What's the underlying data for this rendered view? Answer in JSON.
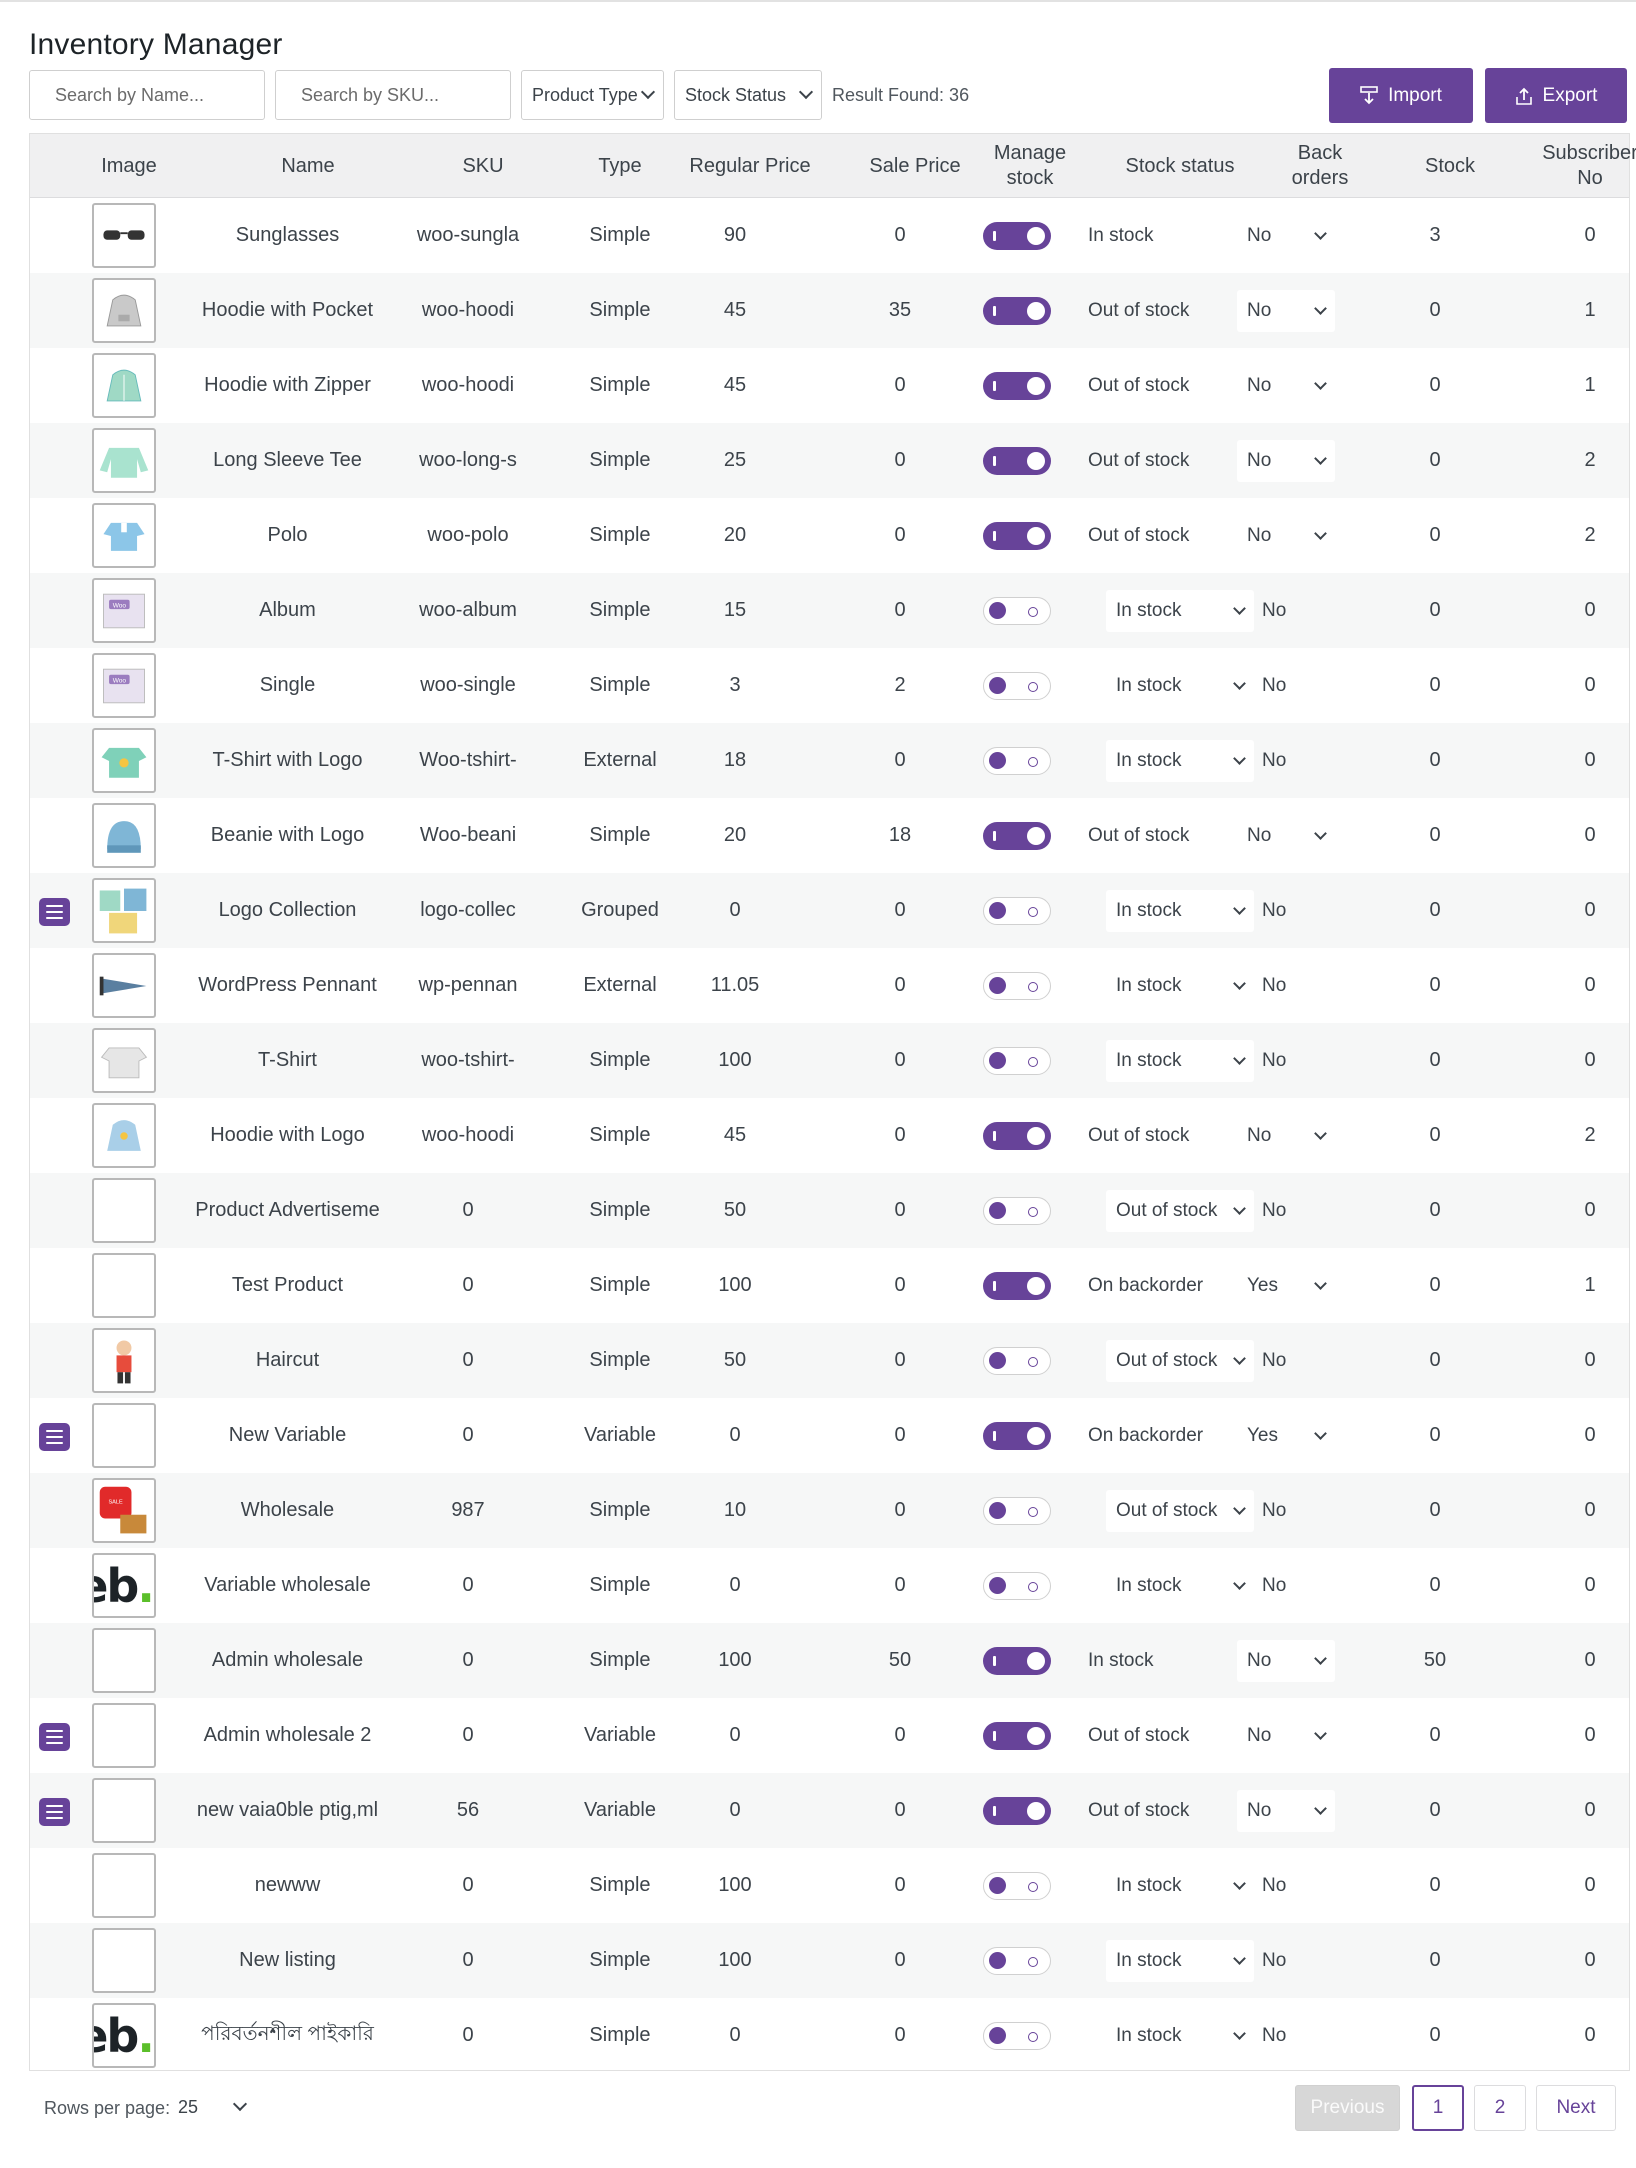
{
  "app": {
    "title": "Inventory Manager"
  },
  "toolbar": {
    "search_name_placeholder": "Search by Name...",
    "search_sku_placeholder": "Search by SKU...",
    "product_type_label": "Product Type",
    "stock_status_label": "Stock Status",
    "result_found": "Result Found: 36",
    "import_label": "Import",
    "export_label": "Export"
  },
  "table": {
    "headers": {
      "image": "Image",
      "name": "Name",
      "sku": "SKU",
      "type": "Type",
      "regular_price": "Regular Price",
      "sale_price": "Sale Price",
      "manage_stock_1": "Manage",
      "manage_stock_2": "stock",
      "stock_status": "Stock status",
      "back_orders_1": "Back",
      "back_orders_2": "orders",
      "stock": "Stock",
      "subscriber_1": "Subscriber",
      "subscriber_2": "No"
    },
    "rows": [
      {
        "image": "sunglasses",
        "variable": false,
        "name": "Sunglasses",
        "sku": "woo-sungla",
        "type": "Simple",
        "regular": "90",
        "sale": "0",
        "manage": true,
        "stock_status": "In stock",
        "backorders": "No",
        "stock": "3",
        "subscribers": "0"
      },
      {
        "image": "hoodie-pocket",
        "variable": false,
        "name": "Hoodie with Pocket",
        "sku": "woo-hoodi",
        "type": "Simple",
        "regular": "45",
        "sale": "35",
        "manage": true,
        "stock_status": "Out of stock",
        "backorders": "No",
        "stock": "0",
        "subscribers": "1"
      },
      {
        "image": "hoodie-zipper",
        "variable": false,
        "name": "Hoodie with Zipper",
        "sku": "woo-hoodi",
        "type": "Simple",
        "regular": "45",
        "sale": "0",
        "manage": true,
        "stock_status": "Out of stock",
        "backorders": "No",
        "stock": "0",
        "subscribers": "1"
      },
      {
        "image": "long-sleeve",
        "variable": false,
        "name": "Long Sleeve Tee",
        "sku": "woo-long-s",
        "type": "Simple",
        "regular": "25",
        "sale": "0",
        "manage": true,
        "stock_status": "Out of stock",
        "backorders": "No",
        "stock": "0",
        "subscribers": "2"
      },
      {
        "image": "polo",
        "variable": false,
        "name": "Polo",
        "sku": "woo-polo",
        "type": "Simple",
        "regular": "20",
        "sale": "0",
        "manage": true,
        "stock_status": "Out of stock",
        "backorders": "No",
        "stock": "0",
        "subscribers": "2"
      },
      {
        "image": "album",
        "variable": false,
        "name": "Album",
        "sku": "woo-album",
        "type": "Simple",
        "regular": "15",
        "sale": "0",
        "manage": false,
        "stock_status": "In stock",
        "backorders": "No",
        "stock": "0",
        "subscribers": "0"
      },
      {
        "image": "single",
        "variable": false,
        "name": "Single",
        "sku": "woo-single",
        "type": "Simple",
        "regular": "3",
        "sale": "2",
        "manage": false,
        "stock_status": "In stock",
        "backorders": "No",
        "stock": "0",
        "subscribers": "0"
      },
      {
        "image": "tshirt-logo",
        "variable": false,
        "name": "T-Shirt with Logo",
        "sku": "Woo-tshirt-",
        "type": "External",
        "regular": "18",
        "sale": "0",
        "manage": false,
        "stock_status": "In stock",
        "backorders": "No",
        "stock": "0",
        "subscribers": "0"
      },
      {
        "image": "beanie",
        "variable": false,
        "name": "Beanie with Logo",
        "sku": "Woo-beani",
        "type": "Simple",
        "regular": "20",
        "sale": "18",
        "manage": true,
        "stock_status": "Out of stock",
        "backorders": "No",
        "stock": "0",
        "subscribers": "0"
      },
      {
        "image": "logo-collection",
        "variable": true,
        "name": "Logo Collection",
        "sku": "logo-collec",
        "type": "Grouped",
        "regular": "0",
        "sale": "0",
        "manage": false,
        "stock_status": "In stock",
        "backorders": "No",
        "stock": "0",
        "subscribers": "0"
      },
      {
        "image": "pennant",
        "variable": false,
        "name": "WordPress Pennant",
        "sku": "wp-pennan",
        "type": "External",
        "regular": "11.05",
        "sale": "0",
        "manage": false,
        "stock_status": "In stock",
        "backorders": "No",
        "stock": "0",
        "subscribers": "0"
      },
      {
        "image": "tshirt",
        "variable": false,
        "name": "T-Shirt",
        "sku": "woo-tshirt-",
        "type": "Simple",
        "regular": "100",
        "sale": "0",
        "manage": false,
        "stock_status": "In stock",
        "backorders": "No",
        "stock": "0",
        "subscribers": "0"
      },
      {
        "image": "hoodie-logo",
        "variable": false,
        "name": "Hoodie with Logo",
        "sku": "woo-hoodi",
        "type": "Simple",
        "regular": "45",
        "sale": "0",
        "manage": true,
        "stock_status": "Out of stock",
        "backorders": "No",
        "stock": "0",
        "subscribers": "2"
      },
      {
        "image": "",
        "variable": false,
        "name": "Product Advertiseme",
        "sku": "0",
        "type": "Simple",
        "regular": "50",
        "sale": "0",
        "manage": false,
        "stock_status": "Out of stock",
        "backorders": "No",
        "stock": "0",
        "subscribers": "0"
      },
      {
        "image": "",
        "variable": false,
        "name": "Test Product",
        "sku": "0",
        "type": "Simple",
        "regular": "100",
        "sale": "0",
        "manage": true,
        "stock_status": "On backorder",
        "backorders": "Yes",
        "stock": "0",
        "subscribers": "1"
      },
      {
        "image": "haircut",
        "variable": false,
        "name": "Haircut",
        "sku": "0",
        "type": "Simple",
        "regular": "50",
        "sale": "0",
        "manage": false,
        "stock_status": "Out of stock",
        "backorders": "No",
        "stock": "0",
        "subscribers": "0"
      },
      {
        "image": "",
        "variable": true,
        "name": "New Variable",
        "sku": "0",
        "type": "Variable",
        "regular": "0",
        "sale": "0",
        "manage": true,
        "stock_status": "On backorder",
        "backorders": "Yes",
        "stock": "0",
        "subscribers": "0"
      },
      {
        "image": "wholesale",
        "variable": false,
        "name": "Wholesale",
        "sku": "987",
        "type": "Simple",
        "regular": "10",
        "sale": "0",
        "manage": false,
        "stock_status": "Out of stock",
        "backorders": "No",
        "stock": "0",
        "subscribers": "0"
      },
      {
        "image": "eb",
        "variable": false,
        "name": "Variable wholesale",
        "sku": "0",
        "type": "Simple",
        "regular": "0",
        "sale": "0",
        "manage": false,
        "stock_status": "In stock",
        "backorders": "No",
        "stock": "0",
        "subscribers": "0"
      },
      {
        "image": "",
        "variable": false,
        "name": "Admin wholesale",
        "sku": "0",
        "type": "Simple",
        "regular": "100",
        "sale": "50",
        "manage": true,
        "stock_status": "In stock",
        "backorders": "No",
        "stock": "50",
        "subscribers": "0"
      },
      {
        "image": "",
        "variable": true,
        "name": "Admin wholesale 2",
        "sku": "0",
        "type": "Variable",
        "regular": "0",
        "sale": "0",
        "manage": true,
        "stock_status": "Out of stock",
        "backorders": "No",
        "stock": "0",
        "subscribers": "0"
      },
      {
        "image": "",
        "variable": true,
        "name": "new vaia0ble ptig,ml",
        "sku": "56",
        "type": "Variable",
        "regular": "0",
        "sale": "0",
        "manage": true,
        "stock_status": "Out of stock",
        "backorders": "No",
        "stock": "0",
        "subscribers": "0"
      },
      {
        "image": "",
        "variable": false,
        "name": "newww",
        "sku": "0",
        "type": "Simple",
        "regular": "100",
        "sale": "0",
        "manage": false,
        "stock_status": "In stock",
        "backorders": "No",
        "stock": "0",
        "subscribers": "0"
      },
      {
        "image": "",
        "variable": false,
        "name": "New listing",
        "sku": "0",
        "type": "Simple",
        "regular": "100",
        "sale": "0",
        "manage": false,
        "stock_status": "In stock",
        "backorders": "No",
        "stock": "0",
        "subscribers": "0"
      },
      {
        "image": "eb",
        "variable": false,
        "name": "পরিবর্তনশীল পাইকারি",
        "sku": "0",
        "type": "Simple",
        "regular": "0",
        "sale": "0",
        "manage": false,
        "stock_status": "In stock",
        "backorders": "No",
        "stock": "0",
        "subscribers": "0"
      }
    ]
  },
  "footer": {
    "rows_per_page_label": "Rows per page:",
    "rows_per_page_value": "25",
    "previous_label": "Previous",
    "page_1": "1",
    "page_2": "2",
    "next_label": "Next"
  },
  "colors": {
    "accent": "#674399",
    "row_alt": "#f6f7f7",
    "header_bg": "#f0f0f1"
  }
}
